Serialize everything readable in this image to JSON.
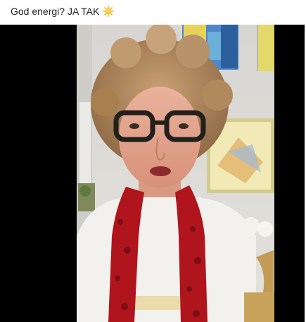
{
  "post": {
    "caption": "God energi? JA TAK",
    "caption_emoji": "sun-emoji-icon"
  },
  "colors": {
    "text": "#1c1e21",
    "letterbox": "#000000",
    "scarf": "#b0151e"
  }
}
